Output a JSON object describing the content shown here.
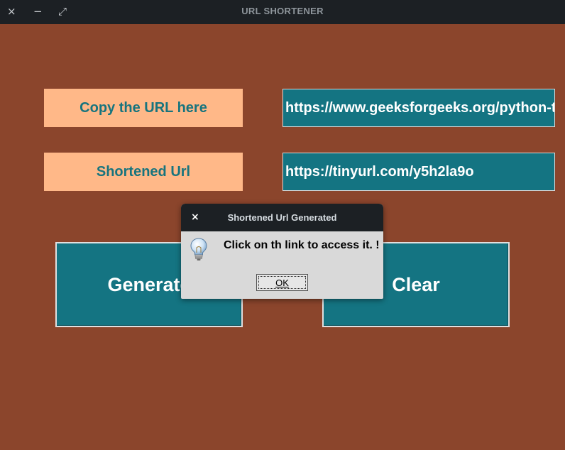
{
  "window": {
    "title": "URL SHORTENER",
    "close_icon": "×",
    "minimize_icon": "−",
    "maximize_icon": "⤢"
  },
  "form": {
    "url_label": "Copy the URL here",
    "url_value": "https://www.geeksforgeeks.org/python-tkinter-tutorial/",
    "short_label": "Shortened Url",
    "short_value": "https://tinyurl.com/y5h2la9o"
  },
  "buttons": {
    "generate": "Generate",
    "clear": "Clear"
  },
  "dialog": {
    "title": "Shortened Url Generated",
    "close_icon": "×",
    "message": "Click on th link to access it. !",
    "ok_label": "OK",
    "icon": "lightbulb-icon"
  },
  "colors": {
    "background": "#8b452c",
    "label_bg": "#ffb888",
    "label_text": "#17747e",
    "field_bg": "#147482",
    "titlebar": "#1c2024"
  }
}
